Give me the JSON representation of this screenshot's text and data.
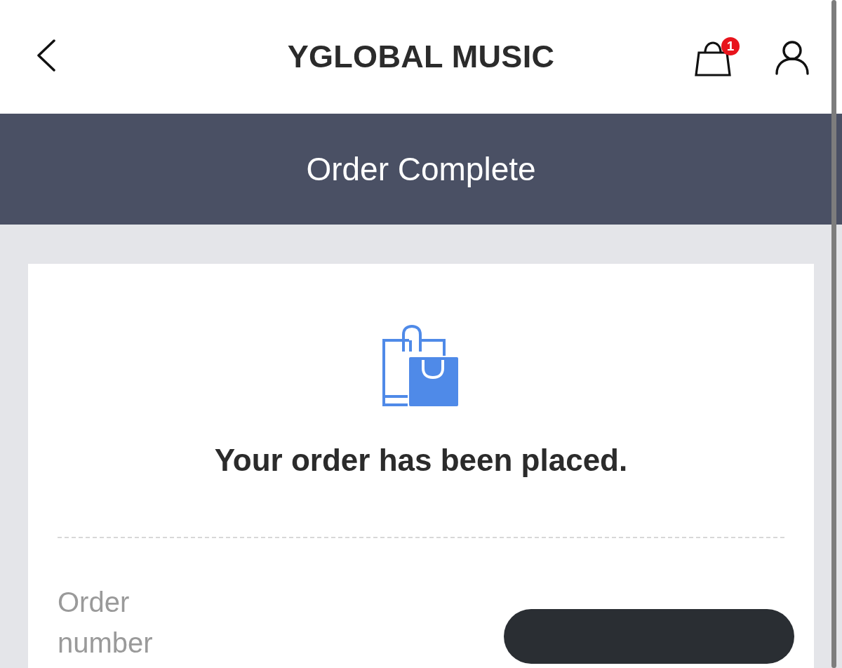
{
  "header": {
    "title": "YGLOBAL MUSIC",
    "cart_badge": "1"
  },
  "banner": {
    "title": "Order Complete"
  },
  "confirmation": {
    "message": "Your order has been placed."
  },
  "details": [
    {
      "label": "Order number",
      "value_redacted": true
    }
  ]
}
